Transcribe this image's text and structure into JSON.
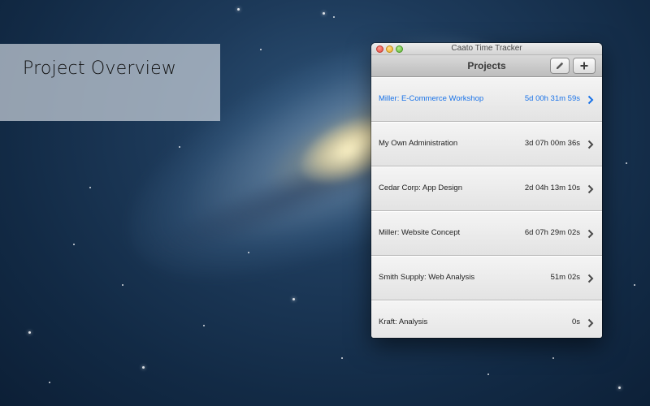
{
  "overlay": {
    "title": "Project Overview"
  },
  "window": {
    "title": "Caato Time Tracker",
    "toolbar": {
      "title": "Projects",
      "edit_icon": "pencil-icon",
      "add_icon": "plus-icon"
    },
    "projects": [
      {
        "name": "Miller: E-Commerce Workshop",
        "time": "5d 00h 31m 59s",
        "selected": true
      },
      {
        "name": "My Own Administration",
        "time": "3d 07h 00m 36s",
        "selected": false
      },
      {
        "name": "Cedar Corp: App Design",
        "time": "2d 04h 13m 10s",
        "selected": false
      },
      {
        "name": "Miller: Website Concept",
        "time": "6d 07h 29m 02s",
        "selected": false
      },
      {
        "name": "Smith Supply: Web Analysis",
        "time": "51m 02s",
        "selected": false
      },
      {
        "name": "Kraft: Analysis",
        "time": "0s",
        "selected": false
      }
    ]
  },
  "colors": {
    "selected_text": "#1a73e8",
    "close": "#e0443a",
    "minimize": "#e6a823",
    "zoom": "#5cb335"
  }
}
